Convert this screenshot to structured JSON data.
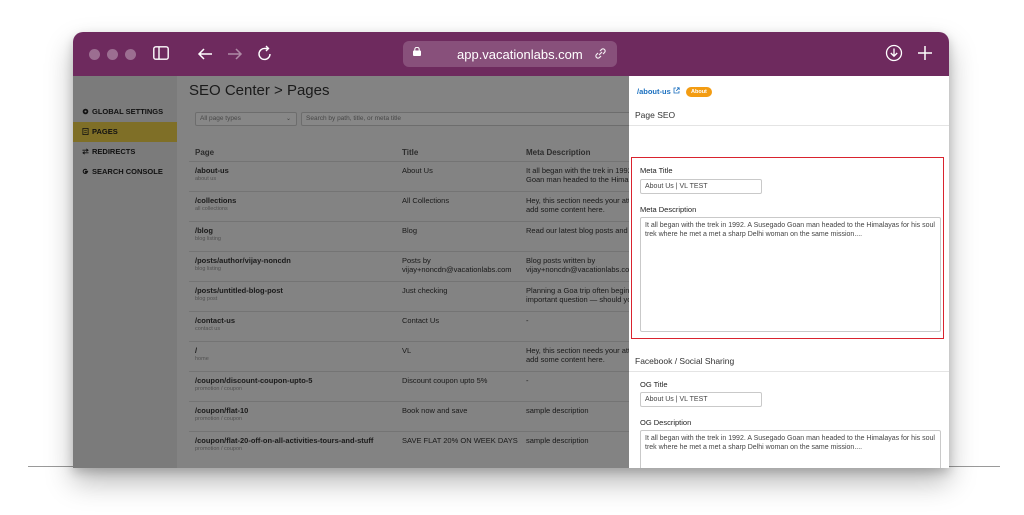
{
  "browser": {
    "url": "app.vacationlabs.com",
    "icons": [
      "sidebar-icon",
      "back-icon",
      "forward-icon",
      "reload-icon",
      "lock-icon",
      "link-icon",
      "download-icon",
      "new-tab-icon"
    ]
  },
  "sidebar": {
    "items": [
      {
        "label": "GLOBAL SETTINGS",
        "icon": "gear-icon"
      },
      {
        "label": "PAGES",
        "icon": "document-icon",
        "active": true
      },
      {
        "label": "REDIRECTS",
        "icon": "redirect-icon"
      },
      {
        "label": "SEARCH CONSOLE",
        "icon": "google-icon"
      }
    ]
  },
  "main": {
    "title": "SEO Center > Pages",
    "filter_select": "All page types",
    "search_placeholder": "Search by path, title, or meta title",
    "columns": {
      "page": "Page",
      "title": "Title",
      "meta": "Meta Description"
    },
    "rows": [
      {
        "page": "/about-us",
        "sub": "about us",
        "title": "About Us",
        "desc": [
          "It all began with the trek in 1992.",
          "Goan man headed to the Himala"
        ]
      },
      {
        "page": "/collections",
        "sub": "all collections",
        "title": "All Collections",
        "desc": [
          "Hey, this section needs your atte",
          "add some content here."
        ]
      },
      {
        "page": "/blog",
        "sub": "blog listing",
        "title": "Blog",
        "desc": [
          "Read our latest blog posts and t"
        ]
      },
      {
        "page": "/posts/author/vijay-noncdn",
        "sub": "blog listing",
        "title": "Posts by vijay+noncdn@vacationlabs.com",
        "desc": [
          "Blog posts written by",
          "vijay+noncdn@vacationlabs.com"
        ]
      },
      {
        "page": "/posts/untitled-blog-post",
        "sub": "blog post",
        "title": "Just checking",
        "desc": [
          "Planning a Goa trip often begins",
          "important question — should yo"
        ]
      },
      {
        "page": "/contact-us",
        "sub": "contact us",
        "title": "Contact Us",
        "desc": [
          "-"
        ]
      },
      {
        "page": "/",
        "sub": "home",
        "title": "VL",
        "desc": [
          "Hey, this section needs your atte",
          "add some content here."
        ]
      },
      {
        "page": "/coupon/discount-coupon-upto-5",
        "sub": "promotion / coupon",
        "title": "Discount coupon upto 5%",
        "desc": [
          "-"
        ]
      },
      {
        "page": "/coupon/flat-10",
        "sub": "promotion / coupon",
        "title": "Book now and save",
        "desc": [
          "sample description"
        ]
      },
      {
        "page": "/coupon/flat-20-off-on-all-activities-tours-and-stuff",
        "sub": "promotion / coupon",
        "title": "SAVE FLAT 20% ON WEEK DAYS",
        "desc": [
          "sample description"
        ]
      }
    ]
  },
  "panel": {
    "page_link": "/about-us",
    "badge": "About",
    "page_seo_heading": "Page SEO",
    "meta_title_label": "Meta Title",
    "meta_title_value": "About Us | VL TEST",
    "meta_desc_label": "Meta Description",
    "meta_desc_value": "It all began with the trek in 1992. A Susegado Goan man headed to the Himalayas for his soul trek where he met a met a sharp Delhi woman on the same mission....",
    "social_heading": "Facebook / Social Sharing",
    "og_title_label": "OG Title",
    "og_title_value": "About Us | VL TEST",
    "og_desc_label": "OG Description",
    "og_desc_value": "It all began with the trek in 1992. A Susegado Goan man headed to the Himalayas for his soul trek where he met a met a sharp Delhi woman on the same mission....",
    "highlight_color": "#d9232e"
  },
  "colors": {
    "titlebar": "#6e2a5e",
    "active_nav": "#f0d24a",
    "badge": "#f39c12",
    "link": "#1a6fbf"
  }
}
